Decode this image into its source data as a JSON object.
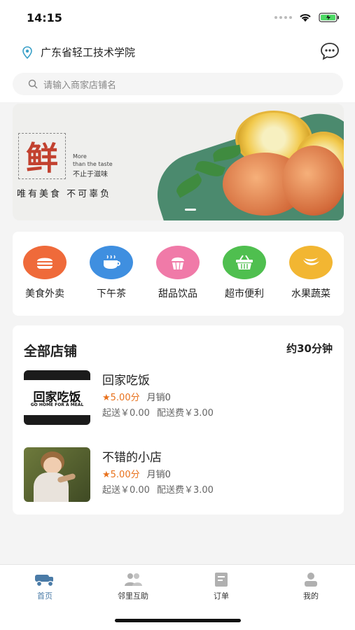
{
  "status_bar": {
    "time": "14:15"
  },
  "header": {
    "location": "广东省轻工技术学院"
  },
  "search": {
    "placeholder": "请输入商家店铺名"
  },
  "banner": {
    "big_char": "鲜",
    "en_line1": "More",
    "en_line2": "than the taste",
    "cn_small": "不止于滋味",
    "slogan": "唯有美食 不可辜负"
  },
  "categories": [
    {
      "label": "美食外卖",
      "color": "#ef6a3a",
      "icon": "burger-icon"
    },
    {
      "label": "下午茶",
      "color": "#3f8fe0",
      "icon": "coffee-cup-icon"
    },
    {
      "label": "甜品饮品",
      "color": "#f07aa8",
      "icon": "cupcake-icon"
    },
    {
      "label": "超市便利",
      "color": "#4fbf4f",
      "icon": "shopping-basket-icon"
    },
    {
      "label": "水果蔬菜",
      "color": "#f2b632",
      "icon": "banana-icon"
    }
  ],
  "stores": {
    "title": "全部店铺",
    "time": "约30分钟",
    "items": [
      {
        "name": "回家吃饭",
        "thumb_text": "回家吃饭",
        "thumb_sub": "GO HOME FOR A MEAL",
        "rating": "★5.00分",
        "sales": "月销0",
        "min_order": "起送￥0.00",
        "delivery_fee": "配送费￥3.00"
      },
      {
        "name": "不错的小店",
        "rating": "★5.00分",
        "sales": "月销0",
        "min_order": "起送￥0.00",
        "delivery_fee": "配送费￥3.00"
      }
    ]
  },
  "tabbar": [
    {
      "label": "首页",
      "icon": "home-icon",
      "active": true
    },
    {
      "label": "邻里互助",
      "icon": "people-icon",
      "active": false
    },
    {
      "label": "订单",
      "icon": "order-icon",
      "active": false
    },
    {
      "label": "我的",
      "icon": "user-icon",
      "active": false
    }
  ],
  "colors": {
    "accent": "#4a7ba7",
    "rating": "#e8711c"
  }
}
